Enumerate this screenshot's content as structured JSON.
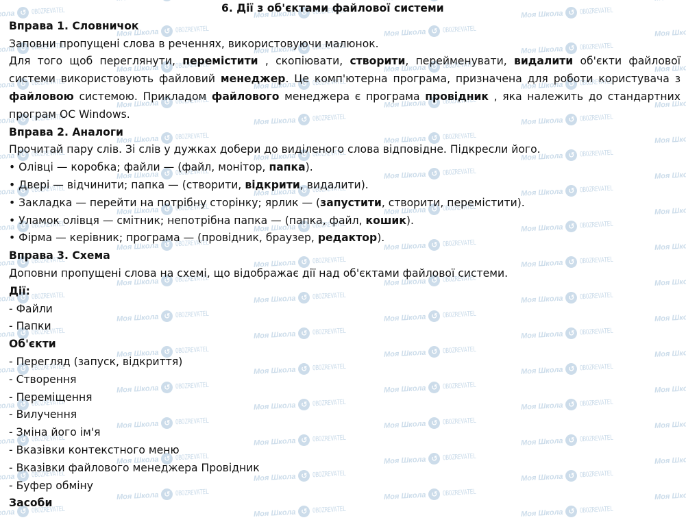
{
  "title": "6. Дії з об'єктами файлової системи",
  "watermark": {
    "school_text": "Моя Школа",
    "brand_text": "OBOZREVATEL",
    "logo_icon": "obozrevatel-logo-icon",
    "color": "#c7d9e8"
  },
  "exercise1": {
    "heading": "Вправа 1. Словничок",
    "instruction": "Заповни пропущені слова в реченнях, використовуючи малюнок.",
    "paragraph": [
      {
        "text": "Для того щоб переглянути, ",
        "bold": false
      },
      {
        "text": "перемістити",
        "bold": true
      },
      {
        "text": " , скопіювати, ",
        "bold": false
      },
      {
        "text": "створити",
        "bold": true
      },
      {
        "text": ", перейменувати, ",
        "bold": false
      },
      {
        "text": "видалити",
        "bold": true
      },
      {
        "text": " об'єкти файлової системи використовують файловий ",
        "bold": false
      },
      {
        "text": "менеджер",
        "bold": true
      },
      {
        "text": ". Це комп'ютерна програма, призначена для роботи користувача з ",
        "bold": false
      },
      {
        "text": "файловою",
        "bold": true
      },
      {
        "text": " системою. Прикладом ",
        "bold": false
      },
      {
        "text": "файлового",
        "bold": true
      },
      {
        "text": " менеджера є програма ",
        "bold": false
      },
      {
        "text": "провідник",
        "bold": true
      },
      {
        "text": " , яка належить до стандартних програм ОС Windows.",
        "bold": false
      }
    ]
  },
  "exercise2": {
    "heading": "Вправа 2. Аналоги",
    "instruction": "Прочитай пару слів. Зі слів у дужках добери до виділеного слова відповідне. Підкресли його.",
    "items": [
      {
        "before": "• Олівці — коробка; файли — (файл, монітор, ",
        "answer": "папка",
        "after": ")."
      },
      {
        "before": "• Двері — відчинити; папка — (створити, ",
        "answer": "відкрити",
        "after": ", видалити)."
      },
      {
        "before": "• Закладка — перейти на потрібну сторінку; ярлик — (",
        "answer": "запустити",
        "after": ", створити, перемістити)."
      },
      {
        "before": "• Уламок олівця — смітник; непотрібна папка — (папка, файл, ",
        "answer": "кошик",
        "after": ")."
      },
      {
        "before": "• Фірма — керівник; програма — (провідник, браузер, ",
        "answer": "редактор",
        "after": ")."
      }
    ]
  },
  "exercise3": {
    "heading": "Вправа 3. Схема",
    "instruction": "Доповни пропущені слова на схемі, що відображає дії над об'єктами файлової системи.",
    "groups": [
      {
        "heading": "Дії:",
        "items": [
          "- Файли",
          "- Папки"
        ]
      },
      {
        "heading": "Об'єкти",
        "items": [
          "- Перегляд (запуск, відкриття)",
          "- Створення",
          "- Переміщення",
          "- Вилучення",
          "- Зміна його ім'я",
          "- Вказівки контекстного меню",
          "- Вказівки файлового менеджера Провідник",
          "- Буфер обміну"
        ]
      },
      {
        "heading": "Засоби",
        "items": []
      }
    ]
  }
}
